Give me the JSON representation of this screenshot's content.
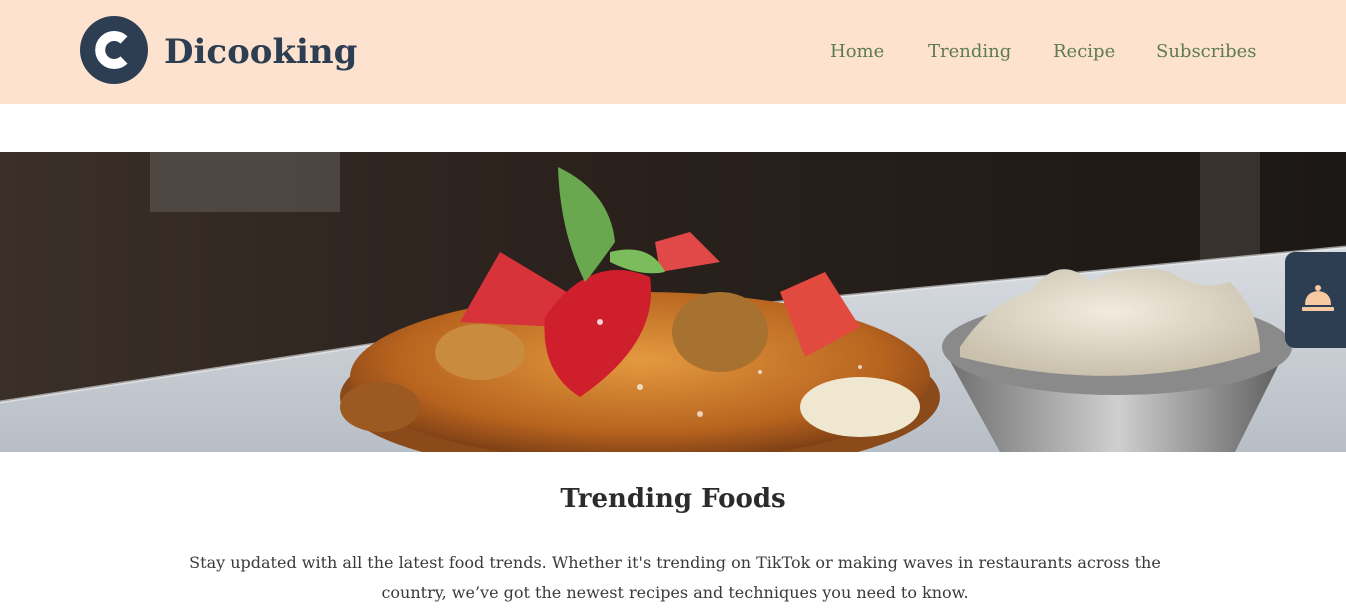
{
  "header": {
    "brand": "Dicooking",
    "logo_icon": "c-logo-icon",
    "nav": [
      "Home",
      "Trending",
      "Recipe",
      "Subscribes"
    ]
  },
  "hero": {
    "image": "pancake-dessert-with-strawberries-and-cream"
  },
  "floating_button": {
    "icon": "service-bell-icon"
  },
  "section": {
    "title": "Trending Foods",
    "description": "Stay updated with all the latest food trends. Whether it's trending on TikTok or making waves in restaurants across the country, we’ve got the newest recipes and techniques you need to know."
  },
  "colors": {
    "header_bg": "#fde3cf",
    "brand_navy": "#2e3e52",
    "nav_green": "#5e7a55"
  }
}
